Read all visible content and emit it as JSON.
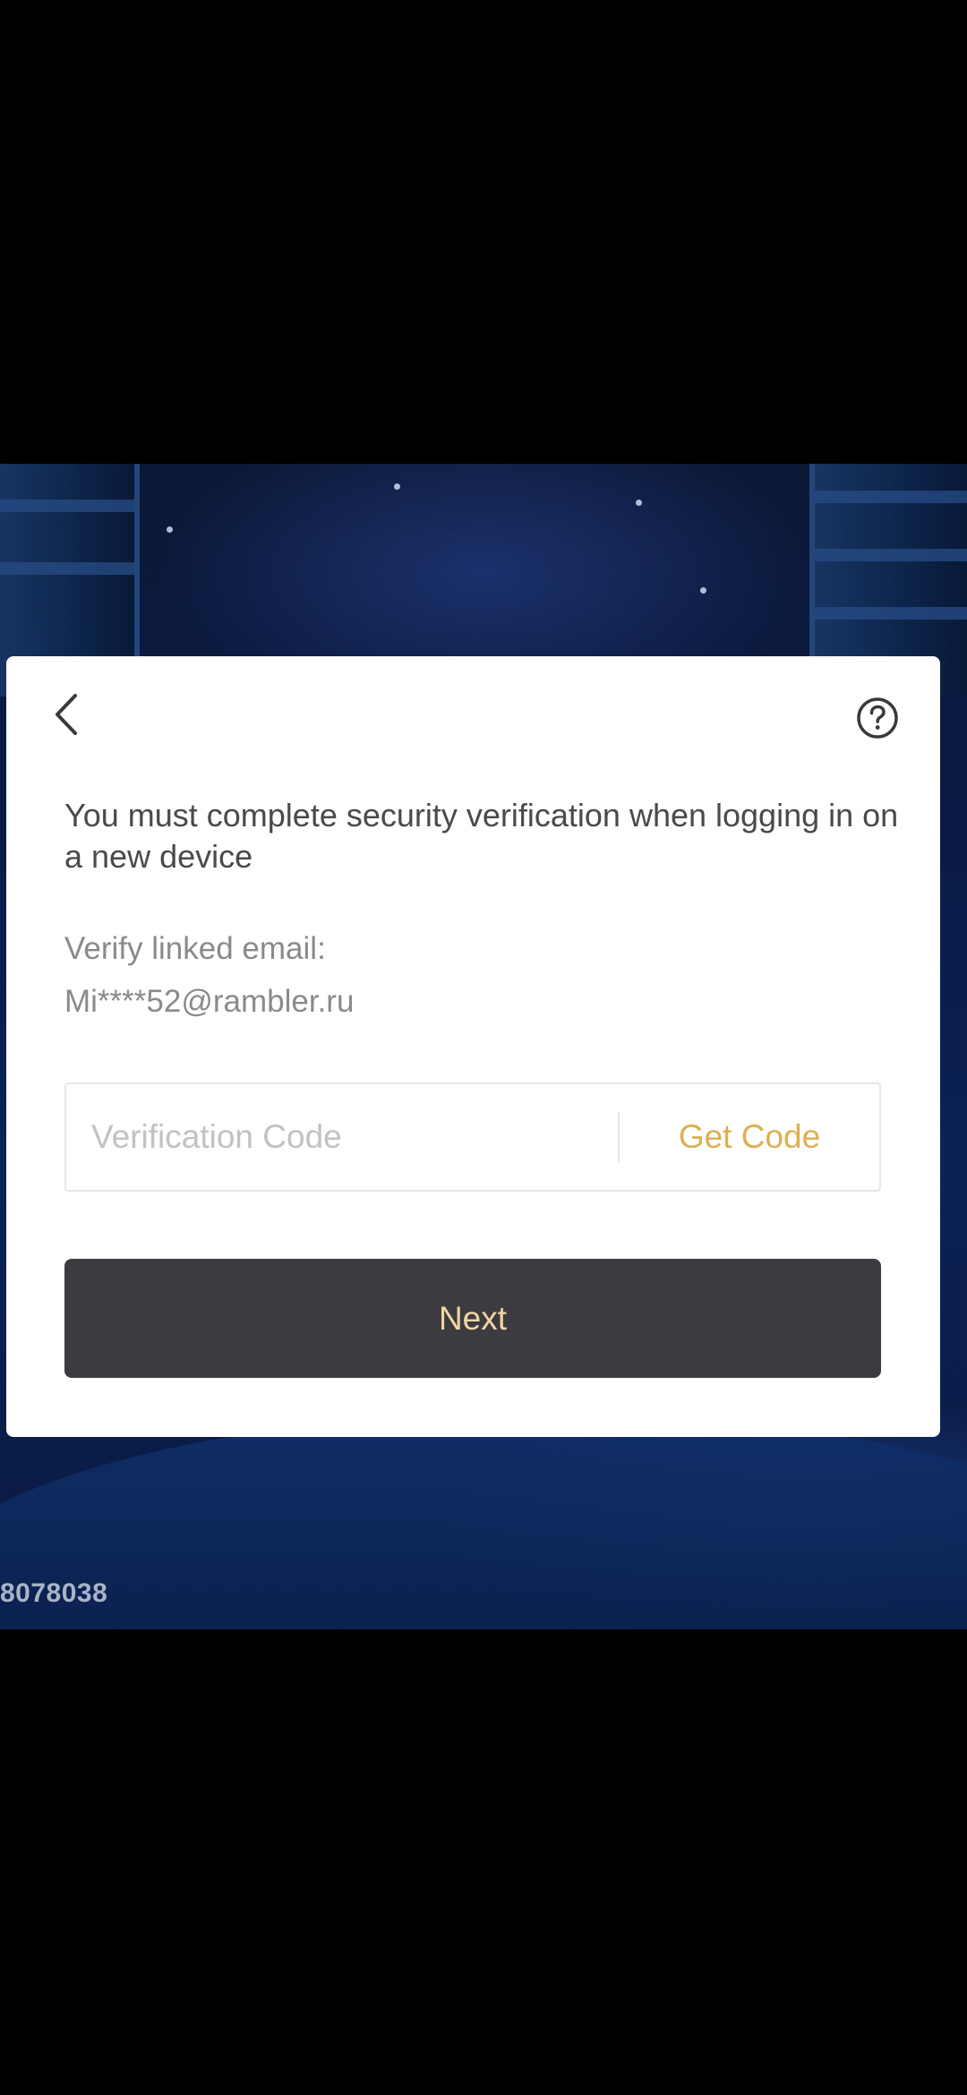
{
  "dialog": {
    "message": "You must complete security verification when logging in on a new device",
    "verify_label": "Verify linked email:",
    "verify_email": "Mi****52@rambler.ru",
    "code_input": {
      "value": "",
      "placeholder": "Verification Code"
    },
    "get_code_label": "Get Code",
    "next_label": "Next",
    "back_icon": "chevron-left-icon",
    "help_icon": "question-circle-icon"
  },
  "background": {
    "build_id": "8078038"
  },
  "colors": {
    "accent_gold": "#dcb053",
    "next_button_bg": "#3c3c40",
    "next_button_text": "#f1d6a2"
  }
}
